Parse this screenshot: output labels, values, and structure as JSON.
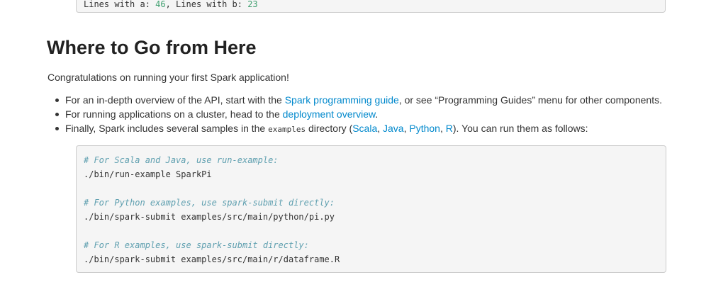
{
  "previous_code": {
    "line_prefix_a": "Lines with a: ",
    "count_a": "46",
    "line_sep": ", Lines with b: ",
    "count_b": "23"
  },
  "section": {
    "title": "Where to Go from Here",
    "intro": "Congratulations on running your first Spark application!"
  },
  "bullets": [
    {
      "pre": "For an in-depth overview of the API, start with the ",
      "link": "Spark programming guide",
      "post": ", or see “Programming Guides” menu for other components."
    },
    {
      "pre": "For running applications on a cluster, head to the ",
      "link": "deployment overview",
      "post": "."
    },
    {
      "pre": "Finally, Spark includes several samples in the ",
      "code": "examples",
      "mid": " directory (",
      "links": [
        "Scala",
        "Java",
        "Python",
        "R"
      ],
      "sep": ", ",
      "post": "). You can run them as follows:"
    }
  ],
  "code_block": {
    "lines": [
      {
        "type": "comment",
        "text": "# For Scala and Java, use run-example:"
      },
      {
        "type": "code",
        "text": "./bin/run-example SparkPi"
      },
      {
        "type": "comment",
        "text": "# For Python examples, use spark-submit directly:"
      },
      {
        "type": "code",
        "text": "./bin/spark-submit examples/src/main/python/pi.py"
      },
      {
        "type": "comment",
        "text": "# For R examples, use spark-submit directly:"
      },
      {
        "type": "code",
        "text": "./bin/spark-submit examples/src/main/r/dataframe.R"
      }
    ]
  },
  "colors": {
    "link": "#0088cc",
    "comment": "#60a0b0",
    "number": "#40a070",
    "text": "#333333",
    "heading": "#222222",
    "code_bg": "#f5f5f5",
    "code_border": "#cccccc"
  }
}
